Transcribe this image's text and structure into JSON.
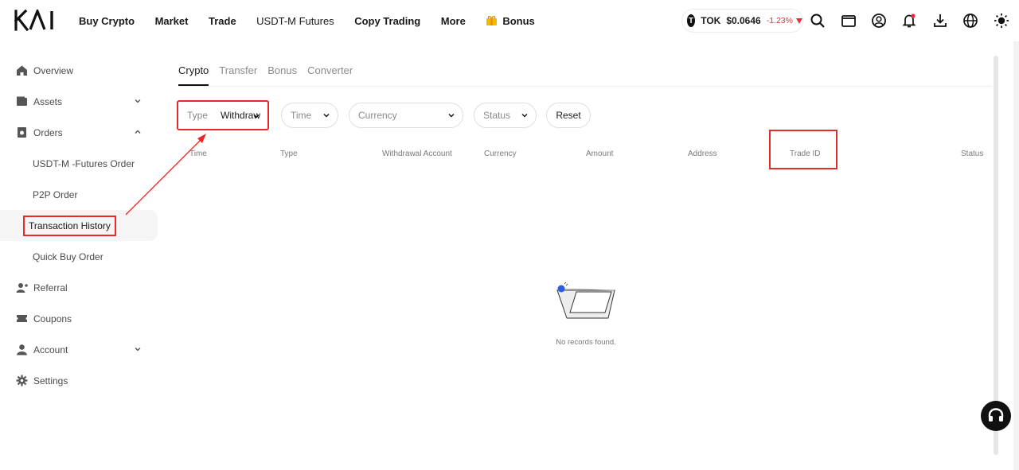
{
  "brand": {
    "logo_text": "KAI"
  },
  "nav": {
    "items": [
      "Buy Crypto",
      "Market",
      "Trade",
      "USDT-M Futures",
      "Copy Trading",
      "More"
    ],
    "bonus_label": "Bonus"
  },
  "ticker": {
    "symbol": "TOK",
    "price": "$0.0646",
    "change": "-1.23%",
    "change_color": "#e5303b"
  },
  "toolbar_icons": [
    "search-icon",
    "wallet-icon",
    "user-icon",
    "bell-icon",
    "download-icon",
    "globe-icon",
    "theme-sun-icon"
  ],
  "sidebar": {
    "items": [
      {
        "label": "Overview",
        "icon": "home-icon"
      },
      {
        "label": "Assets",
        "icon": "wallet-icon"
      },
      {
        "label": "Orders",
        "icon": "orders-icon"
      }
    ],
    "orders_sub": [
      "USDT-M -Futures Order",
      "P2P Order",
      "Transaction History",
      "Quick Buy Order"
    ],
    "items_after": [
      {
        "label": "Referral",
        "icon": "referral-icon"
      },
      {
        "label": "Coupons",
        "icon": "coupon-icon"
      },
      {
        "label": "Account",
        "icon": "account-icon"
      },
      {
        "label": "Settings",
        "icon": "settings-icon"
      }
    ]
  },
  "tabs": [
    "Crypto",
    "Transfer",
    "Bonus",
    "Converter"
  ],
  "filters": {
    "type_label": "Type",
    "type_value": "Withdraw",
    "time_placeholder": "Time",
    "currency_placeholder": "Currency",
    "status_placeholder": "Status",
    "reset_label": "Reset"
  },
  "table": {
    "columns": [
      "Time",
      "Type",
      "Withdrawal Account",
      "Currency",
      "Amount",
      "Address",
      "Trade ID",
      "Status"
    ]
  },
  "empty_state": {
    "text": "No records found."
  },
  "colors": {
    "accent_red": "#e82a2a",
    "text_dark": "#1a1a1a",
    "text_muted": "#8a8a8a"
  }
}
